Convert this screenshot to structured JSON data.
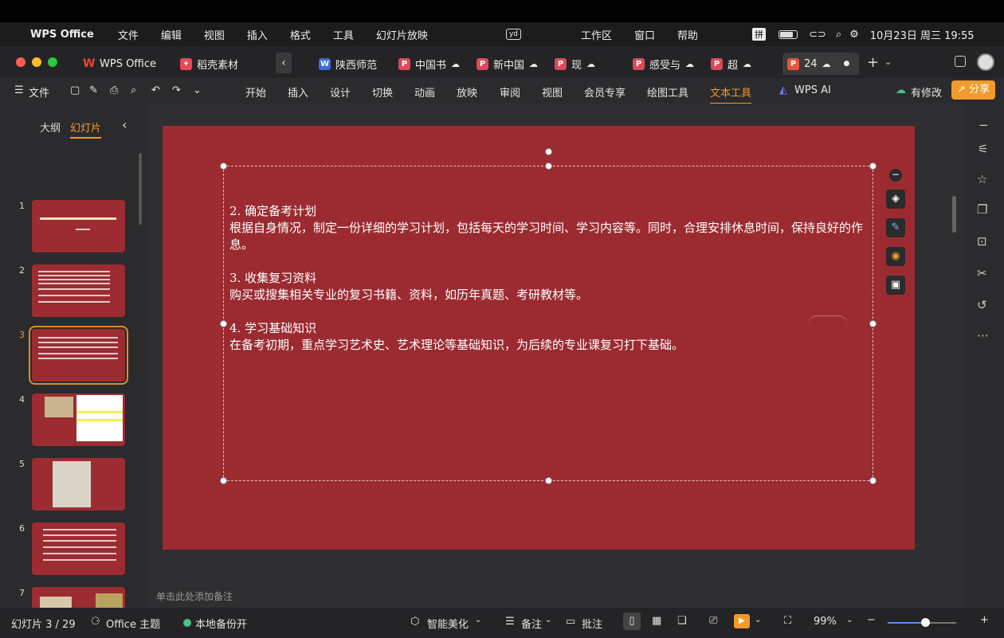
{
  "menubar": {
    "app": "WPS Office",
    "items": [
      "文件",
      "编辑",
      "视图",
      "插入",
      "格式",
      "工具",
      "幻灯片放映"
    ],
    "center_items": [
      "工作区",
      "窗口",
      "帮助"
    ],
    "input_method": "拼",
    "datetime": "10月23日 周三  19:55",
    "yd": "yd"
  },
  "tabs": [
    {
      "label": "WPS Office",
      "icon": "W"
    },
    {
      "label": "稻壳素材",
      "icon": "D"
    },
    {
      "label": "陕西师范",
      "icon": "W"
    },
    {
      "label": "中国书",
      "icon": "P"
    },
    {
      "label": "新中国",
      "icon": "P"
    },
    {
      "label": "现",
      "icon": "P"
    },
    {
      "label": "感受与",
      "icon": "P"
    },
    {
      "label": "超",
      "icon": "P"
    },
    {
      "label": "24",
      "icon": "P"
    }
  ],
  "toolbar": {
    "file": "文件",
    "menus": [
      "开始",
      "插入",
      "设计",
      "切换",
      "动画",
      "放映",
      "审阅",
      "视图",
      "会员专享",
      "绘图工具",
      "文本工具"
    ],
    "active": "文本工具",
    "ai": "WPS AI",
    "modify": "有修改",
    "share": "分享"
  },
  "sidebar": {
    "outline_tab": "大纲",
    "slides_tab": "幻灯片",
    "slide_numbers": [
      "1",
      "2",
      "3",
      "4",
      "5",
      "6",
      "7"
    ],
    "add": "+"
  },
  "slide": {
    "paragraphs": [
      {
        "heading": "2. 确定备考计划",
        "body": "根据自身情况，制定一份详细的学习计划，包括每天的学习时间、学习内容等。同时，合理安排休息时间，保持良好的作息。"
      },
      {
        "heading": "3. 收集复习资料",
        "body": "购买或搜集相关专业的复习书籍、资料，如历年真题、考研教材等。"
      },
      {
        "heading": "4. 学习基础知识",
        "body": "在备考初期，重点学习艺术史、艺术理论等基础知识，为后续的专业课复习打下基础。"
      }
    ]
  },
  "notes_placeholder": "单击此处添加备注",
  "status": {
    "slide_count": "幻灯片 3 / 29",
    "theme": "Office 主题",
    "backup": "本地备份开",
    "beautify": "智能美化",
    "notes": "备注",
    "comment": "批注",
    "zoom": "99%",
    "zoom_level": 0.55
  },
  "colors": {
    "slide_bg": "#9b2b31",
    "accent": "#f39a2c",
    "selected_border": "#e08a2a"
  }
}
